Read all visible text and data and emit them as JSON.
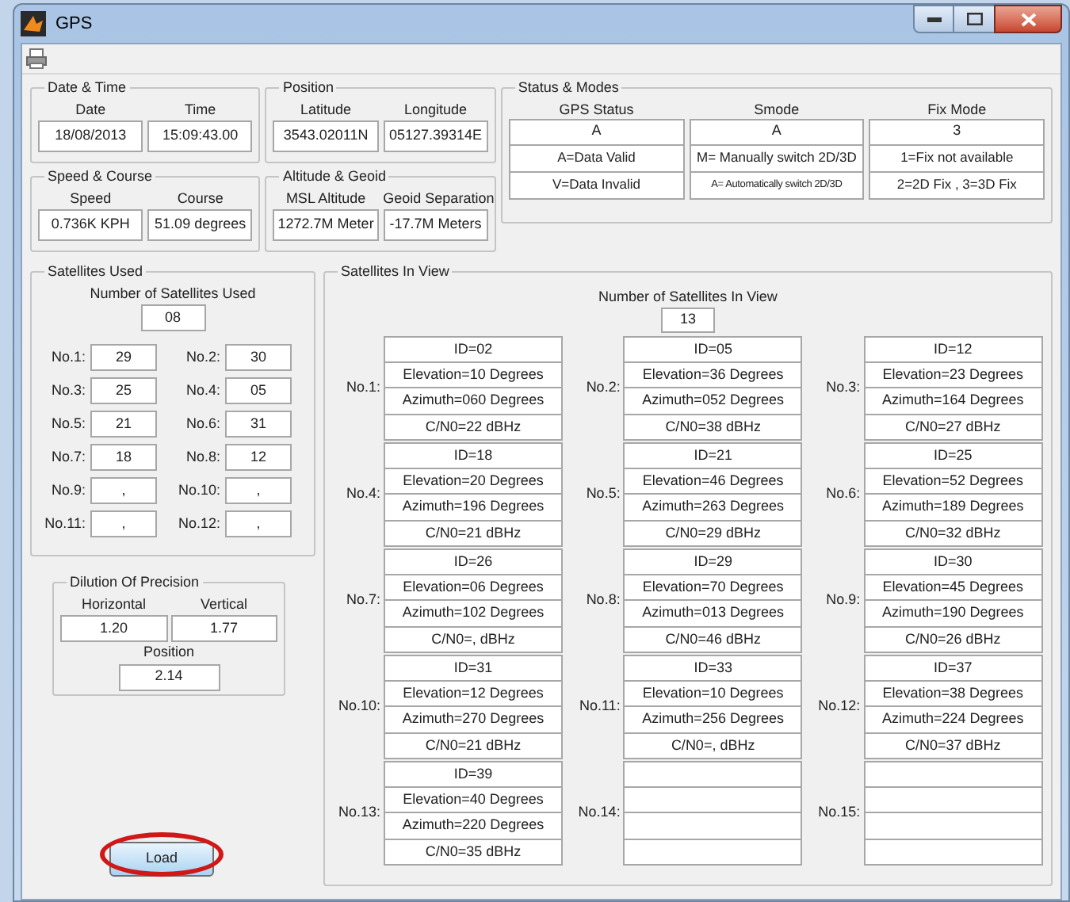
{
  "window": {
    "title": "GPS"
  },
  "top_groups": [
    {
      "title": "Date & Time",
      "fields": [
        {
          "label": "Date",
          "value": "18/08/2013"
        },
        {
          "label": "Time",
          "value": "15:09:43.00"
        }
      ]
    },
    {
      "title": "Position",
      "fields": [
        {
          "label": "Latitude",
          "value": "3543.02011N"
        },
        {
          "label": "Longitude",
          "value": "05127.39314E"
        }
      ]
    },
    {
      "title": "Speed & Course",
      "fields": [
        {
          "label": "Speed",
          "value": "0.736K  KPH"
        },
        {
          "label": "Course",
          "value": "51.09 degrees"
        }
      ]
    },
    {
      "title": "Altitude & Geoid",
      "fields": [
        {
          "label": "MSL Altitude",
          "value": "1272.7M  Meter"
        },
        {
          "label": "Geoid Separation",
          "value": "-17.7M  Meters"
        }
      ]
    }
  ],
  "status_modes": {
    "title": "Status & Modes",
    "columns": [
      {
        "heading": "GPS Status",
        "value": "A",
        "notes": [
          "A=Data Valid",
          "V=Data Invalid"
        ]
      },
      {
        "heading": "Smode",
        "value": "A",
        "notes": [
          "M= Manually switch 2D/3D",
          "A= Automatically switch 2D/3D"
        ]
      },
      {
        "heading": "Fix Mode",
        "value": "3",
        "notes": [
          "1=Fix not available",
          "2=2D Fix , 3=3D Fix"
        ]
      }
    ]
  },
  "satellites_used": {
    "title": "Satellites Used",
    "count_label": "Number of Satellites Used",
    "count": "08",
    "slots": [
      {
        "label": "No.1:",
        "value": "29"
      },
      {
        "label": "No.2:",
        "value": "30"
      },
      {
        "label": "No.3:",
        "value": "25"
      },
      {
        "label": "No.4:",
        "value": "05"
      },
      {
        "label": "No.5:",
        "value": "21"
      },
      {
        "label": "No.6:",
        "value": "31"
      },
      {
        "label": "No.7:",
        "value": "18"
      },
      {
        "label": "No.8:",
        "value": "12"
      },
      {
        "label": "No.9:",
        "value": ","
      },
      {
        "label": "No.10:",
        "value": ","
      },
      {
        "label": "No.11:",
        "value": ","
      },
      {
        "label": "No.12:",
        "value": ","
      }
    ]
  },
  "dilution_of_precision": {
    "title": "Dilution Of Precision",
    "fields": [
      {
        "label": "Horizontal",
        "value": "1.20"
      },
      {
        "label": "Vertical",
        "value": "1.77"
      },
      {
        "label": "Position",
        "value": "2.14"
      }
    ]
  },
  "satellites_in_view": {
    "title": "Satellites In View",
    "count_label": "Number of Satellites In View",
    "count": "13",
    "satellites": [
      {
        "label": "No.1:",
        "lines": [
          "ID=02",
          "Elevation=10 Degrees",
          "Azimuth=060 Degrees",
          "C/N0=22 dBHz"
        ]
      },
      {
        "label": "No.2:",
        "lines": [
          "ID=05",
          "Elevation=36 Degrees",
          "Azimuth=052 Degrees",
          "C/N0=38 dBHz"
        ]
      },
      {
        "label": "No.3:",
        "lines": [
          "ID=12",
          "Elevation=23 Degrees",
          "Azimuth=164 Degrees",
          "C/N0=27 dBHz"
        ]
      },
      {
        "label": "No.4:",
        "lines": [
          "ID=18",
          "Elevation=20 Degrees",
          "Azimuth=196 Degrees",
          "C/N0=21 dBHz"
        ]
      },
      {
        "label": "No.5:",
        "lines": [
          "ID=21",
          "Elevation=46 Degrees",
          "Azimuth=263 Degrees",
          "C/N0=29 dBHz"
        ]
      },
      {
        "label": "No.6:",
        "lines": [
          "ID=25",
          "Elevation=52 Degrees",
          "Azimuth=189 Degrees",
          "C/N0=32 dBHz"
        ]
      },
      {
        "label": "No.7:",
        "lines": [
          "ID=26",
          "Elevation=06 Degrees",
          "Azimuth=102 Degrees",
          "C/N0=, dBHz"
        ]
      },
      {
        "label": "No.8:",
        "lines": [
          "ID=29",
          "Elevation=70 Degrees",
          "Azimuth=013 Degrees",
          "C/N0=46 dBHz"
        ]
      },
      {
        "label": "No.9:",
        "lines": [
          "ID=30",
          "Elevation=45 Degrees",
          "Azimuth=190 Degrees",
          "C/N0=26 dBHz"
        ]
      },
      {
        "label": "No.10:",
        "lines": [
          "ID=31",
          "Elevation=12 Degrees",
          "Azimuth=270 Degrees",
          "C/N0=21 dBHz"
        ]
      },
      {
        "label": "No.11:",
        "lines": [
          "ID=33",
          "Elevation=10 Degrees",
          "Azimuth=256 Degrees",
          "C/N0=, dBHz"
        ]
      },
      {
        "label": "No.12:",
        "lines": [
          "ID=37",
          "Elevation=38 Degrees",
          "Azimuth=224 Degrees",
          "C/N0=37 dBHz"
        ]
      },
      {
        "label": "No.13:",
        "lines": [
          "ID=39",
          "Elevation=40 Degrees",
          "Azimuth=220 Degrees",
          "C/N0=35 dBHz"
        ]
      },
      {
        "label": "No.14:"
      },
      {
        "label": "No.15:"
      }
    ]
  },
  "load_button": {
    "label": "Load",
    "circled": true
  }
}
